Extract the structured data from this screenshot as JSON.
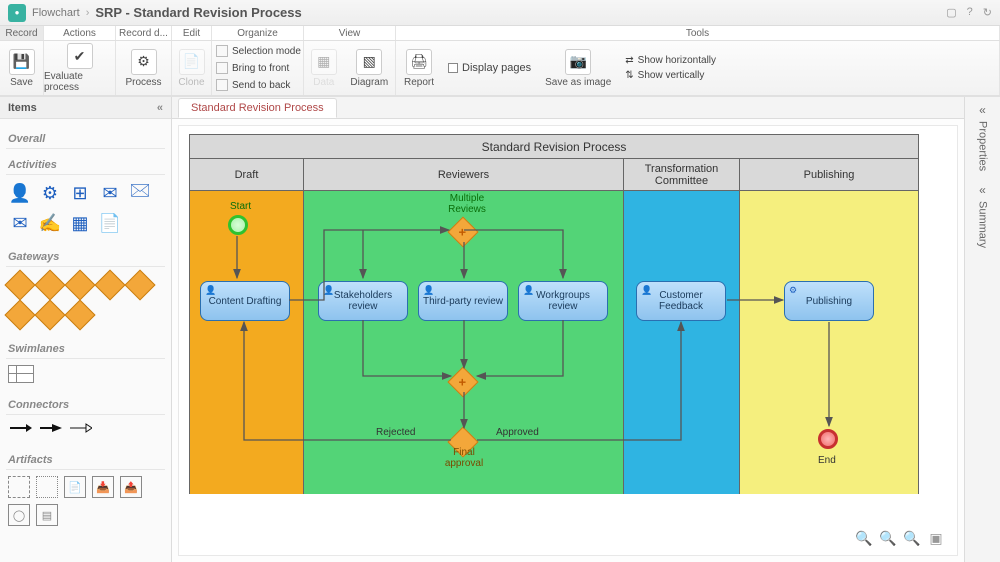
{
  "breadcrumb": {
    "app": "Flowchart",
    "title": "SRP - Standard Revision Process"
  },
  "ribbon_tabs": {
    "record": "Record",
    "actions": "Actions",
    "record_data": "Record d...",
    "edit": "Edit",
    "organize": "Organize",
    "view": "View",
    "tools": "Tools"
  },
  "ribbon": {
    "save": "Save",
    "evaluate": "Evaluate process",
    "process": "Process",
    "clone": "Clone",
    "selection_mode": "Selection mode",
    "bring_front": "Bring to front",
    "send_back": "Send to back",
    "data": "Data",
    "diagram": "Diagram",
    "report": "Report",
    "display_pages": "Display pages",
    "save_as_image": "Save as image",
    "show_h": "Show horizontally",
    "show_v": "Show vertically"
  },
  "left_panel": {
    "title": "Items",
    "overall": "Overall",
    "activities": "Activities",
    "gateways": "Gateways",
    "swimlanes": "Swimlanes",
    "connectors": "Connectors",
    "artifacts": "Artifacts"
  },
  "doc_tab": "Standard Revision Process",
  "pool_title": "Standard Revision Process",
  "lanes": {
    "draft": "Draft",
    "reviewers": "Reviewers",
    "tc": "Transformation Committee",
    "pub": "Publishing"
  },
  "nodes": {
    "start": "Start",
    "content_drafting": "Content Drafting",
    "multiple_reviews": "Multiple Reviews",
    "stakeholders": "Stakeholders review",
    "third_party": "Third-party review",
    "workgroups": "Workgroups review",
    "final_approval": "Final approval",
    "customer_feedback": "Customer Feedback",
    "publishing": "Publishing",
    "end": "End",
    "rejected": "Rejected",
    "approved": "Approved"
  },
  "right_tabs": {
    "properties": "Properties",
    "summary": "Summary"
  }
}
